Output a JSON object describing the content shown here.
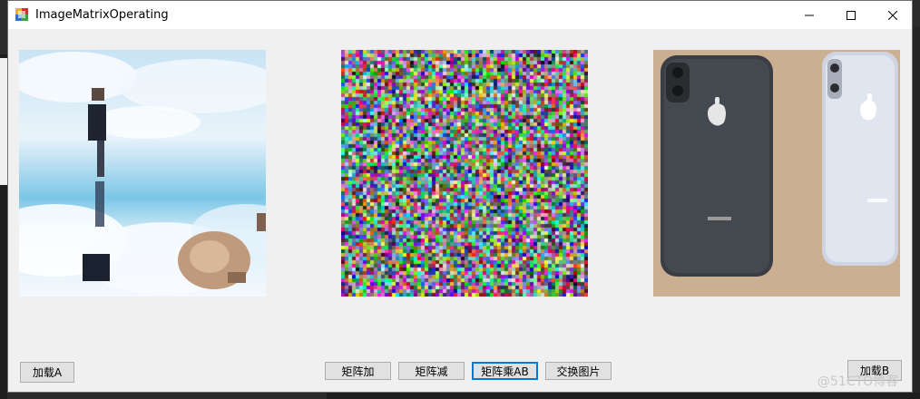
{
  "window": {
    "title": "ImageMatrixOperating"
  },
  "buttons": {
    "load_a": "加载A",
    "matrix_add": "矩阵加",
    "matrix_sub": "矩阵减",
    "matrix_mul": "矩阵乘AB",
    "swap_image": "交换图片",
    "load_b": "加载B"
  },
  "watermark": "@51CTO博客",
  "icons": {
    "app": "app-icon",
    "minimize": "minimize-icon",
    "maximize": "maximize-icon",
    "close": "close-icon"
  },
  "colors": {
    "focus_border": "#0078d7",
    "button_bg": "#e1e1e1",
    "window_bg": "#f0f0f0"
  }
}
